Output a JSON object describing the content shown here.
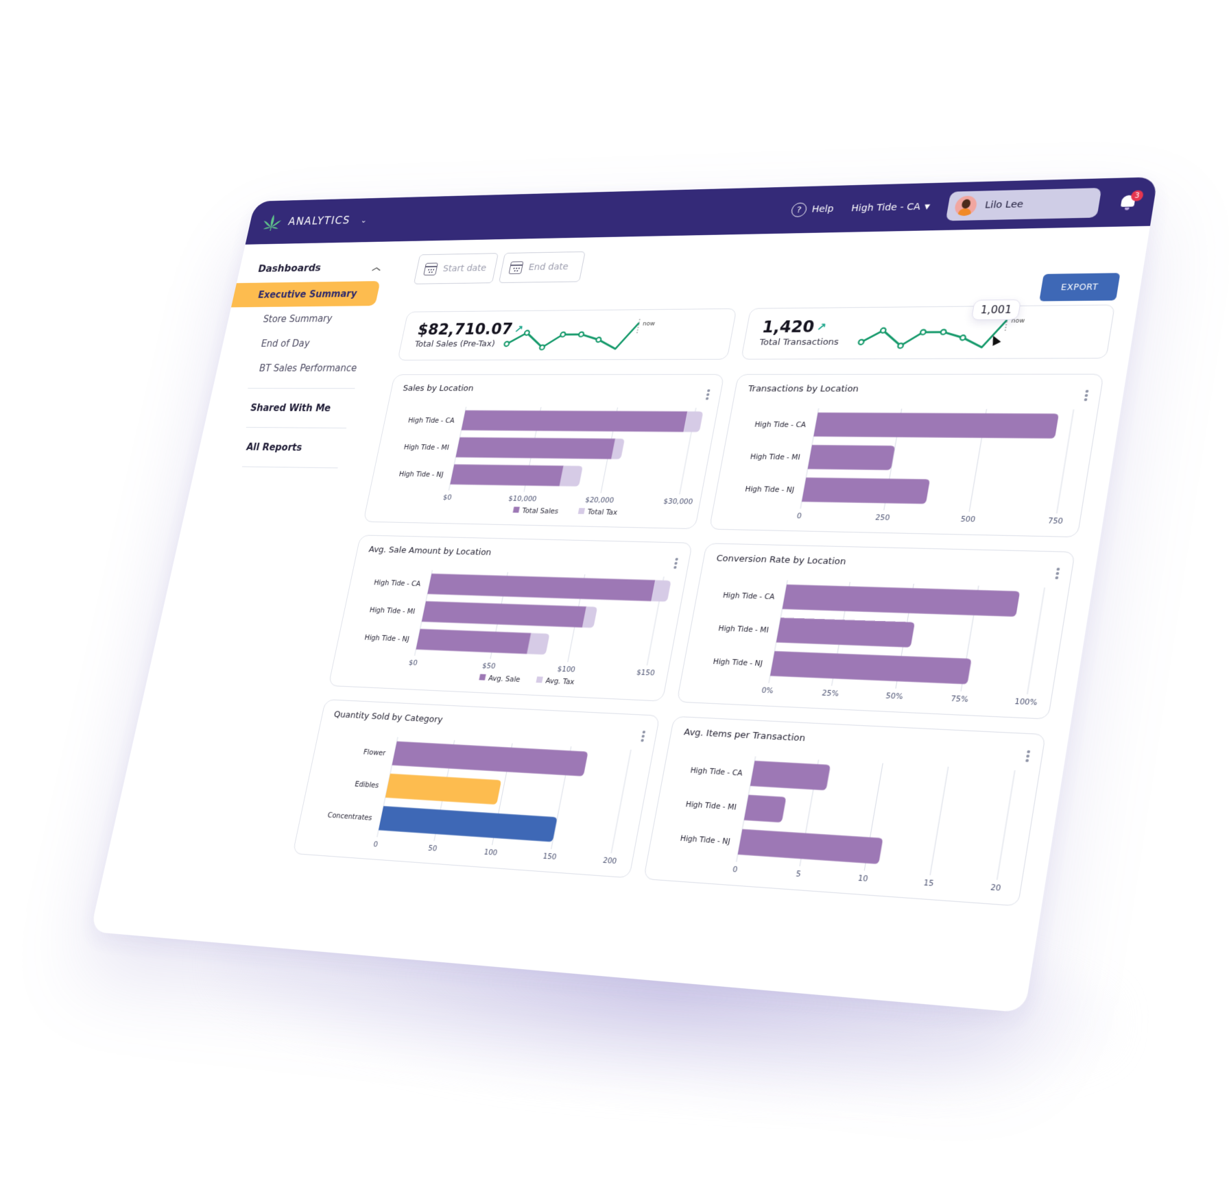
{
  "topbar": {
    "app_name": "ANALYTICS",
    "help_label": "Help",
    "store_selected": "High Tide - CA",
    "user_name": "Lilo Lee",
    "notification_count": "3"
  },
  "sidebar": {
    "section_title": "Dashboards",
    "items": [
      {
        "label": "Executive Summary",
        "active": true
      },
      {
        "label": "Store Summary",
        "active": false
      },
      {
        "label": "End of Day",
        "active": false
      },
      {
        "label": "BT Sales Performance",
        "active": false
      }
    ],
    "links": [
      {
        "label": "Shared With Me"
      },
      {
        "label": "All Reports"
      }
    ]
  },
  "filters": {
    "start_placeholder": "Start date",
    "end_placeholder": "End date"
  },
  "toolbar": {
    "export_label": "EXPORT"
  },
  "kpis": [
    {
      "value": "$82,710.07",
      "label": "Total Sales (Pre-Tax)",
      "trend": "up",
      "now_label": "now",
      "sparkline": [
        3,
        6,
        2,
        5.5,
        5.5,
        4,
        1.5,
        8.5
      ]
    },
    {
      "value": "1,420",
      "label": "Total Transactions",
      "trend": "up",
      "now_label": "now",
      "tooltip": "1,001",
      "sparkline": [
        3,
        6,
        2,
        5.5,
        5.5,
        4,
        1.5,
        8.5
      ]
    }
  ],
  "colors": {
    "brand": "#342a78",
    "accent_active": "#fdbc4f",
    "primary_bar": "#9d78b5",
    "secondary_bar": "#d6cbe6",
    "edibles": "#fdbc4f",
    "concentrates": "#3e68b6",
    "sparkline": "#14996a",
    "export": "#3e68b6"
  },
  "chart_data": [
    {
      "type": "bar",
      "orientation": "horizontal",
      "stacked": true,
      "title": "Sales by Location",
      "categories": [
        "High Tide - CA",
        "High Tide - MI",
        "High Tide - NJ"
      ],
      "series": [
        {
          "name": "Total Sales",
          "values": [
            29000,
            20500,
            14500
          ],
          "color": "#9d78b5"
        },
        {
          "name": "Total Tax",
          "values": [
            2000,
            1200,
            2500
          ],
          "color": "#d6cbe6"
        }
      ],
      "xlim": [
        0,
        30000
      ],
      "ticks": [
        "$0",
        "$10,000",
        "$20,000",
        "$30,000"
      ],
      "tick_values": [
        0,
        10000,
        20000,
        30000
      ],
      "legend": "bottom",
      "grid": true
    },
    {
      "type": "bar",
      "orientation": "horizontal",
      "title": "Transactions by Location",
      "categories": [
        "High Tide - CA",
        "High Tide - MI",
        "High Tide - NJ"
      ],
      "series": [
        {
          "name": "Transactions",
          "values": [
            710,
            250,
            370
          ],
          "color": "#9d78b5"
        }
      ],
      "xlim": [
        0,
        750
      ],
      "ticks": [
        "0",
        "250",
        "500",
        "750"
      ],
      "tick_values": [
        0,
        250,
        500,
        750
      ],
      "legend": "none",
      "grid": true
    },
    {
      "type": "bar",
      "orientation": "horizontal",
      "stacked": true,
      "title": "Avg. Sale Amount by Location",
      "categories": [
        "High Tide - CA",
        "High Tide - MI",
        "High Tide - NJ"
      ],
      "series": [
        {
          "name": "Avg. Sale",
          "values": [
            145,
            105,
            73
          ],
          "color": "#9d78b5"
        },
        {
          "name": "Avg. Tax",
          "values": [
            10,
            7,
            12
          ],
          "color": "#d6cbe6"
        }
      ],
      "xlim": [
        0,
        150
      ],
      "ticks": [
        "$0",
        "$50",
        "$100",
        "$150"
      ],
      "tick_values": [
        0,
        50,
        100,
        150
      ],
      "legend": "bottom",
      "grid": true
    },
    {
      "type": "bar",
      "orientation": "horizontal",
      "title": "Conversion Rate by Location",
      "categories": [
        "High Tide - CA",
        "High Tide - MI",
        "High Tide - NJ"
      ],
      "series": [
        {
          "name": "Conversion Rate",
          "values": [
            91,
            53,
            77
          ],
          "color": "#9d78b5"
        }
      ],
      "xlim": [
        0,
        100
      ],
      "ticks": [
        "0%",
        "25%",
        "50%",
        "75%",
        "100%"
      ],
      "tick_values": [
        0,
        25,
        50,
        75,
        100
      ],
      "legend": "none",
      "grid": true
    },
    {
      "type": "bar",
      "orientation": "horizontal",
      "title": "Quantity Sold by Category",
      "categories": [
        "Flower",
        "Edibles",
        "Concentrates"
      ],
      "series": [
        {
          "name": "Quantity",
          "values": [
            165,
            97,
            150
          ],
          "colors": [
            "#9d78b5",
            "#fdbc4f",
            "#3e68b6"
          ]
        }
      ],
      "xlim": [
        0,
        200
      ],
      "ticks": [
        "0",
        "50",
        "100",
        "150",
        "200"
      ],
      "tick_values": [
        0,
        50,
        100,
        150,
        200
      ],
      "legend": "none",
      "grid": true
    },
    {
      "type": "bar",
      "orientation": "horizontal",
      "title": "Avg. Items per Transaction",
      "categories": [
        "High Tide - CA",
        "High Tide - MI",
        "High Tide - NJ"
      ],
      "series": [
        {
          "name": "Avg. Items",
          "values": [
            6,
            3,
            11
          ],
          "color": "#9d78b5"
        }
      ],
      "xlim": [
        0,
        20
      ],
      "ticks": [
        "0",
        "5",
        "10",
        "15",
        "20"
      ],
      "tick_values": [
        0,
        5,
        10,
        15,
        20
      ],
      "legend": "none",
      "grid": true
    }
  ]
}
